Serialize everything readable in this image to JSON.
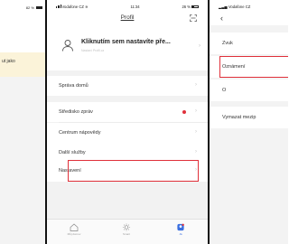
{
  "left_panel": {
    "battery_text": "82 %",
    "note_text": "ut jako"
  },
  "middle_panel": {
    "status": {
      "carrier": "Vodafone CZ",
      "time": "11:34",
      "battery": "26 %"
    },
    "nav": {
      "title": "Profil",
      "scan_icon": "scan-icon"
    },
    "profile": {
      "name": "Kliknutím sem nastavíte pře...",
      "subtitle": "Nastaví Profil.cz"
    },
    "menu": [
      {
        "label": "Správa domů",
        "badge": false
      },
      {
        "label": "Středisko zpráv",
        "badge": true
      },
      {
        "label": "Centrum nápovědy",
        "badge": false
      },
      {
        "label": "Další služby",
        "badge": false
      },
      {
        "label": "Nastavení",
        "badge": false,
        "highlighted": true
      }
    ],
    "tabs": [
      {
        "label": "Můj domov",
        "icon": "home-icon",
        "active": false
      },
      {
        "label": "Smart",
        "icon": "sun-icon",
        "active": false
      },
      {
        "label": "Já",
        "icon": "person-icon",
        "active": true
      }
    ],
    "accent_color": "#3a6fe0",
    "highlight_color": "#e0303a"
  },
  "right_panel": {
    "status": {
      "carrier": "Vodafone CZ"
    },
    "back_icon": "back-arrow-icon",
    "items": [
      {
        "label": "Zvuk"
      },
      {
        "label": "Oznámení",
        "highlighted": true
      },
      {
        "label": "O"
      },
      {
        "label": "Vymazat mezip"
      }
    ]
  }
}
